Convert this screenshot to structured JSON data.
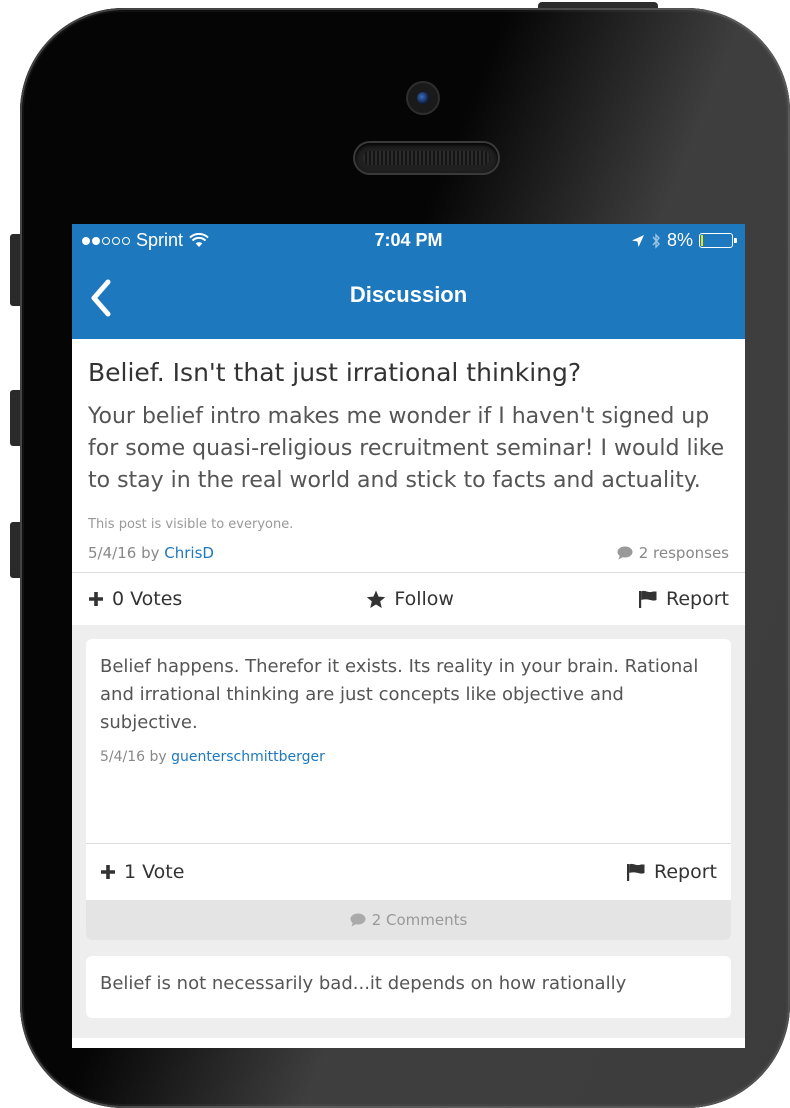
{
  "status_bar": {
    "carrier": "Sprint",
    "signal_bars_filled": 2,
    "signal_bars_total": 5,
    "time": "7:04 PM",
    "battery_percent": "8%",
    "battery_level": 0.08
  },
  "nav": {
    "title": "Discussion"
  },
  "post": {
    "title": "Belief. Isn't that just irrational thinking?",
    "body": "Your belief intro makes me wonder if I haven't signed up for some quasi-religious recruitment seminar! I would like to stay in the real world and stick to facts and actuality.",
    "visibility": "This post is visible to everyone.",
    "date": "5/4/16",
    "by_label": "by",
    "author": "ChrisD",
    "responses": "2 responses",
    "votes_label": "0 Votes",
    "follow_label": "Follow",
    "report_label": "Report"
  },
  "responses": [
    {
      "text": "Belief happens. Therefor it exists. Its reality in your brain. Rational and irrational thinking are just concepts like objective and subjective.",
      "date": "5/4/16",
      "by_label": "by",
      "author": "guenterschmittberger",
      "votes_label": "1 Vote",
      "report_label": "Report",
      "comments_label": "2 Comments"
    },
    {
      "text": "Belief is not necessarily bad...it depends on how rationally"
    }
  ],
  "colors": {
    "brand_blue": "#1d78bd",
    "background_gray": "#eeeeee"
  },
  "icons": [
    "back-chevron-icon",
    "wifi-icon",
    "location-arrow-icon",
    "bluetooth-icon",
    "battery-icon",
    "comment-bubble-icon",
    "plus-icon",
    "star-icon",
    "flag-icon"
  ]
}
